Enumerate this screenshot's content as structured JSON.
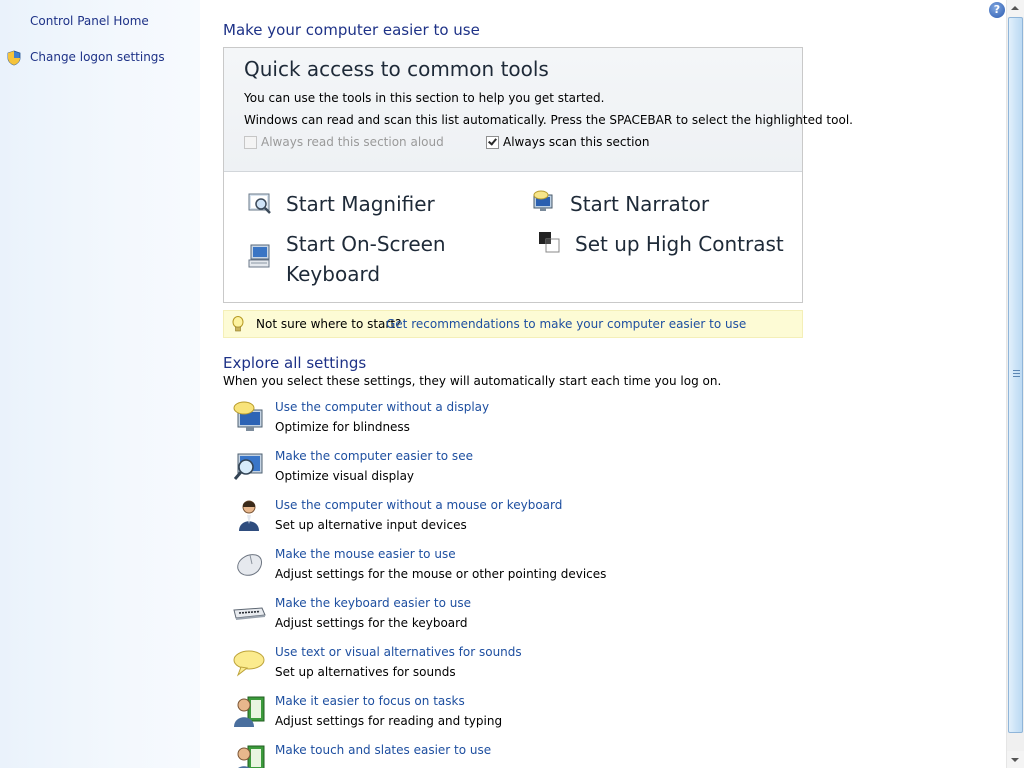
{
  "sidebar": {
    "items": [
      {
        "label": "Control Panel Home"
      },
      {
        "label": "Change logon settings",
        "icon": "shield-icon"
      }
    ]
  },
  "main": {
    "title": "Make your computer easier to use",
    "quick_access": {
      "title": "Quick access to common tools",
      "line1": "You can use the tools in this section to help you get started.",
      "line2": "Windows can read and scan this list automatically.  Press the SPACEBAR to select the highlighted tool.",
      "read_aloud_label": "Always read this section aloud",
      "read_aloud_checked": false,
      "read_aloud_enabled": false,
      "scan_label": "Always scan this section",
      "scan_checked": true,
      "tools": {
        "magnifier": "Start Magnifier",
        "narrator": "Start Narrator",
        "osk_line1": "Start On-Screen",
        "osk_line2": "Keyboard",
        "contrast": "Set up High Contrast"
      }
    },
    "tip": {
      "text": "Not sure where to start?",
      "link": "Get recommendations to make your computer easier to use"
    },
    "explore": {
      "title": "Explore all settings",
      "desc": "When you select these settings, they will automatically start each time you log on.",
      "items": [
        {
          "link": "Use the computer without a display",
          "desc": "Optimize for blindness",
          "icon": "monitor-speech-icon"
        },
        {
          "link": "Make the computer easier to see",
          "desc": "Optimize visual display",
          "icon": "monitor-magnifier-icon"
        },
        {
          "link": "Use the computer without a mouse or keyboard",
          "desc": "Set up alternative input devices",
          "icon": "person-speaking-icon"
        },
        {
          "link": "Make the mouse easier to use",
          "desc": "Adjust settings for the mouse or other pointing devices",
          "icon": "mouse-icon"
        },
        {
          "link": "Make the keyboard easier to use",
          "desc": "Adjust settings for the keyboard",
          "icon": "keyboard-icon"
        },
        {
          "link": "Use text or visual alternatives for sounds",
          "desc": "Set up alternatives for sounds",
          "icon": "speech-bubble-icon"
        },
        {
          "link": "Make it easier to focus on tasks",
          "desc": "Adjust settings for reading and typing",
          "icon": "person-book-icon"
        },
        {
          "link": "Make touch and slates easier to use",
          "desc": "",
          "icon": "person-book-icon"
        }
      ]
    }
  },
  "help_label": "?",
  "colors": {
    "link": "#1e4fa0",
    "heading": "#1e3287",
    "tip_bg": "#fdfbd5"
  }
}
